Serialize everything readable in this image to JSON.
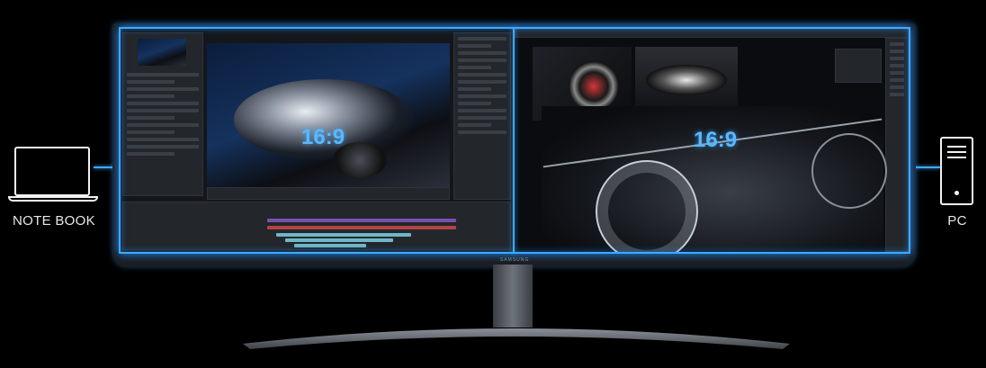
{
  "left_device": {
    "label": "NOTE BOOK",
    "icon": "laptop-icon"
  },
  "right_device": {
    "label": "PC",
    "icon": "desktop-tower-icon"
  },
  "left_screen": {
    "aspect_ratio": "16:9"
  },
  "right_screen": {
    "aspect_ratio": "16:9"
  },
  "brand": "SAMSUNG",
  "colors": {
    "accent": "#3fa9ff",
    "background": "#000000",
    "bezel": "#1a1d22"
  }
}
